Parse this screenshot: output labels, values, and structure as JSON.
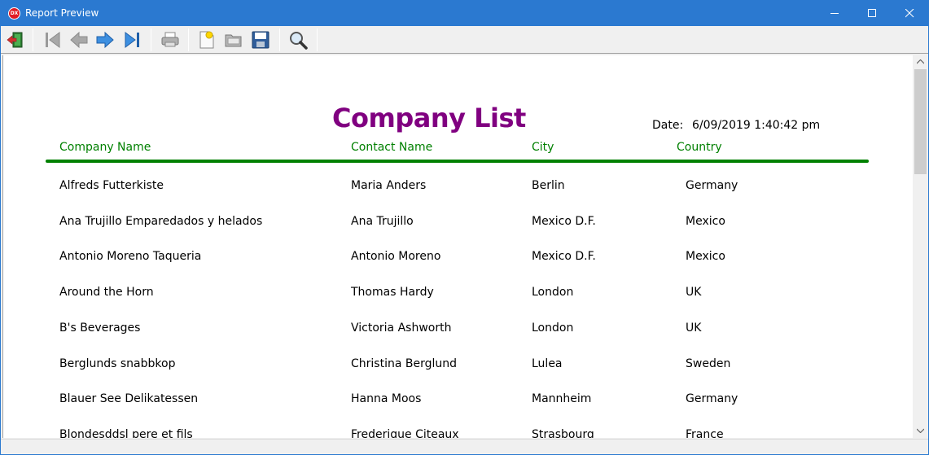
{
  "window": {
    "title": "Report Preview",
    "app_icon_text": "DX"
  },
  "toolbar": {
    "buttons": [
      "exit-icon",
      "first-page-icon",
      "previous-page-icon",
      "next-page-icon",
      "last-page-icon",
      "print-icon",
      "new-icon",
      "open-icon",
      "save-icon",
      "zoom-icon"
    ]
  },
  "report": {
    "title": "Company List",
    "date_label": "Date:",
    "date_value": "6/09/2019 1:40:42 pm",
    "columns": [
      "Company Name",
      "Contact Name",
      "City",
      "Country"
    ],
    "rows": [
      [
        "Alfreds Futterkiste",
        "Maria Anders",
        "Berlin",
        "Germany"
      ],
      [
        "Ana Trujillo Emparedados y helados",
        "Ana Trujillo",
        "Mexico D.F.",
        "Mexico"
      ],
      [
        "Antonio Moreno Taqueria",
        "Antonio Moreno",
        "Mexico D.F.",
        "Mexico"
      ],
      [
        "Around the Horn",
        "Thomas Hardy",
        "London",
        "UK"
      ],
      [
        "B's Beverages",
        "Victoria Ashworth",
        "London",
        "UK"
      ],
      [
        "Berglunds snabbkop",
        "Christina Berglund",
        "Lulea",
        "Sweden"
      ],
      [
        "Blauer See Delikatessen",
        "Hanna Moos",
        "Mannheim",
        "Germany"
      ],
      [
        "Blondesddsl pere et fils",
        "Frederique Citeaux",
        "Strasbourg",
        "France"
      ]
    ]
  },
  "colors": {
    "titlebar": "#2b79d0",
    "report_title": "#800080",
    "header_text": "#008000",
    "rule": "#008000"
  }
}
